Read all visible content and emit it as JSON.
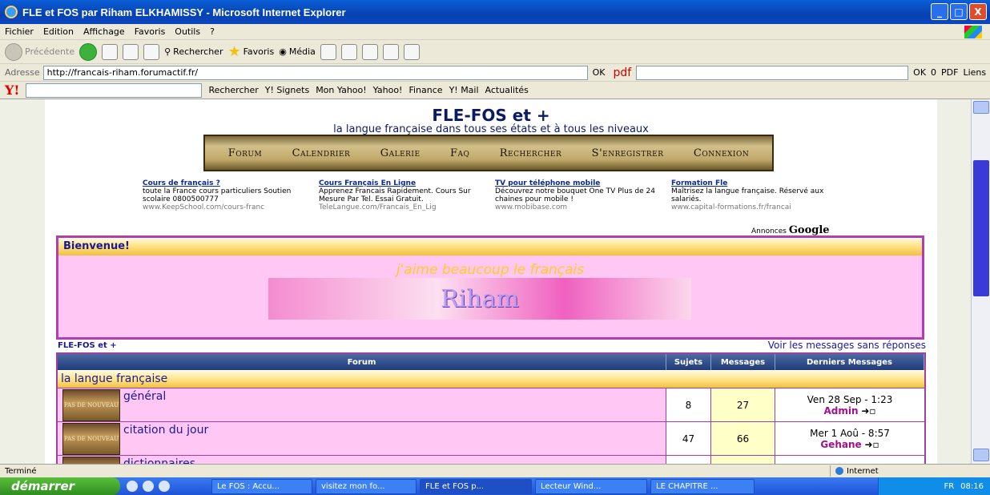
{
  "window": {
    "title": "FLE et FOS par Riham ELKHAMISSY - Microsoft Internet Explorer",
    "min": "_",
    "max": "□",
    "close": "X"
  },
  "menu": [
    "Fichier",
    "Edition",
    "Affichage",
    "Favoris",
    "Outils",
    "?"
  ],
  "toolbar": {
    "back": "Précédente",
    "search": "Rechercher",
    "favorites": "Favoris",
    "media": "Média"
  },
  "address": {
    "label": "Adresse",
    "url": "http://francais-riham.forumactif.fr/",
    "go": "OK",
    "pdf": "pdf",
    "ok2": "OK",
    "count": "0",
    "pdf2": "PDF",
    "links": "Liens"
  },
  "yahoo": {
    "logo": "Y!",
    "search": "Rechercher",
    "items": [
      "Y! Signets",
      "Mon Yahoo!",
      "Yahoo!",
      "Finance",
      "Y! Mail",
      "Actualités"
    ]
  },
  "site": {
    "title": "FLE-FOS et +",
    "subtitle": "la langue française dans tous ses états et à tous les niveaux",
    "nav": [
      "Forum",
      "Calendrier",
      "Galerie",
      "Faq",
      "Rechercher",
      "S'enregistrer",
      "Connexion"
    ]
  },
  "ads": [
    {
      "title": "Cours de français ?",
      "text": "toute la France cours particuliers Soutien scolaire 0800500777",
      "url": "www.KeepSchool.com/cours-franc"
    },
    {
      "title": "Cours Français En Ligne",
      "text": "Apprenez Francais Rapidement. Cours Sur Mesure Par Tel. Essai Gratuit.",
      "url": "TeleLangue.com/Francais_En_Lig"
    },
    {
      "title": "TV pour téléphone mobile",
      "text": "Découvrez notre bouquet One TV Plus de 24 chaines pour mobile !",
      "url": "www.mobibase.com"
    },
    {
      "title": "Formation Fle",
      "text": "Maîtrisez la langue française. Réservé aux salariés.",
      "url": "www.capital-formations.fr/francai"
    }
  ],
  "annonces": {
    "label": "Annonces",
    "brand": "Google"
  },
  "welcome": {
    "title": "Bienvenue!",
    "tagline": "j'aime beaucoup le français",
    "banner": "Riham"
  },
  "breadcrumb": "FLE-FOS et +",
  "unanswered": "Voir les messages sans réponses",
  "forum_table": {
    "headers": [
      "Forum",
      "Sujets",
      "Messages",
      "Derniers Messages"
    ],
    "category": "la langue française",
    "icon_text": "PAS DE NOUVEAU",
    "rows": [
      {
        "name": "général",
        "topics": "8",
        "posts": "27",
        "last_date": "Ven 28 Sep - 1:23",
        "last_user": "Admin"
      },
      {
        "name": "citation du jour",
        "topics": "47",
        "posts": "66",
        "last_date": "Mer 1 Aoû - 8:57",
        "last_user": "Gehane"
      },
      {
        "name": "dictionnaires",
        "topics": "",
        "posts": "",
        "last_date": "",
        "last_user": ""
      }
    ]
  },
  "status": {
    "text": "Terminé",
    "zone": "Internet"
  },
  "taskbar": {
    "start": "démarrer",
    "tasks": [
      "Le FOS : Accu...",
      "visitez mon fo...",
      "FLE et FOS p...",
      "Lecteur Wind...",
      "LE CHAPITRE ..."
    ],
    "lang": "FR",
    "clock": "08:16"
  },
  "colors": {
    "titlebar": "#0842b0",
    "accent": "#a040a0",
    "forum_bg": "#ffc8f4"
  }
}
